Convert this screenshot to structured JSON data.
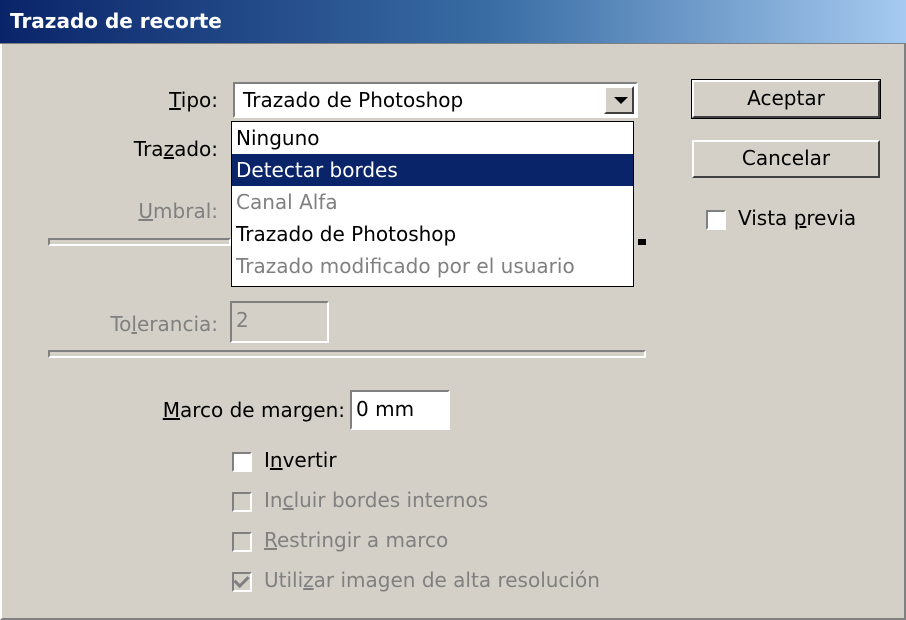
{
  "dialog": {
    "title": "Trazado de recorte"
  },
  "tipo": {
    "label": "Tipo:",
    "value": "Trazado de Photoshop",
    "options": [
      {
        "label": "Ninguno",
        "state": "normal"
      },
      {
        "label": "Detectar bordes",
        "state": "highlighted"
      },
      {
        "label": "Canal Alfa",
        "state": "disabled"
      },
      {
        "label": "Trazado de Photoshop",
        "state": "normal"
      },
      {
        "label": "Trazado modificado por el usuario",
        "state": "disabled"
      }
    ]
  },
  "trazado": {
    "label": "Trazado:"
  },
  "umbral": {
    "label": "Umbral:"
  },
  "tolerancia": {
    "label": "Tolerancia:",
    "value": "2"
  },
  "marco_margen": {
    "label": "Marco de margen:",
    "value": "0 mm"
  },
  "checkboxes": {
    "invertir": {
      "label": "Invertir",
      "checked": false,
      "enabled": true
    },
    "incluir_bordes": {
      "label": "Incluir bordes internos",
      "checked": false,
      "enabled": false
    },
    "restringir": {
      "label": "Restringir a marco",
      "checked": false,
      "enabled": false
    },
    "alta_resolucion": {
      "label": "Utilizar imagen de alta resolución",
      "checked": true,
      "enabled": false
    }
  },
  "buttons": {
    "aceptar": "Aceptar",
    "cancelar": "Cancelar"
  },
  "vista_previa": {
    "label": "Vista previa",
    "checked": false
  }
}
